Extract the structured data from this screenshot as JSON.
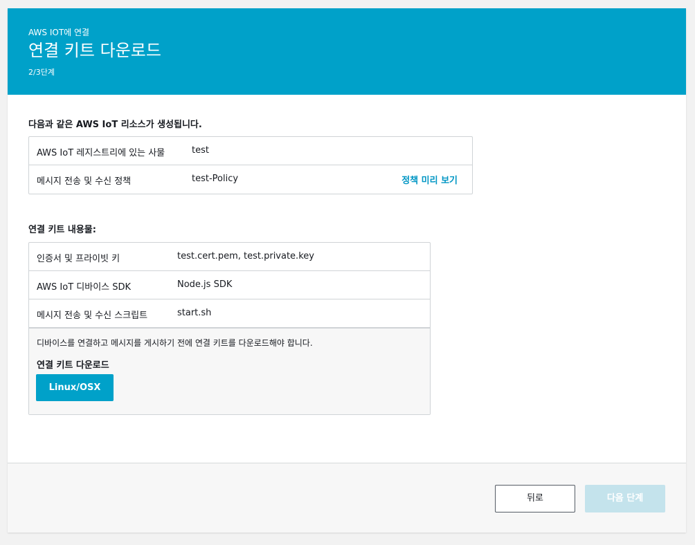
{
  "header": {
    "breadcrumb": "AWS IOT에 연결",
    "title": "연결 키트 다운로드",
    "step": "2/3단계"
  },
  "resources": {
    "title": "다음과 같은 AWS IoT 리소스가 생성됩니다.",
    "rows": [
      {
        "label": "AWS IoT 레지스트리에 있는 사물",
        "value": "test",
        "link": ""
      },
      {
        "label": "메시지 전송 및 수신 정책",
        "value": "test-Policy",
        "link": "정책 미리 보기"
      }
    ]
  },
  "kit": {
    "title": "연결 키트 내용물:",
    "rows": [
      {
        "label": "인증서 및 프라이빗 키",
        "value": "test.cert.pem, test.private.key"
      },
      {
        "label": "AWS IoT 디바이스 SDK",
        "value": "Node.js SDK"
      },
      {
        "label": "메시지 전송 및 수신 스크립트",
        "value": "start.sh"
      }
    ],
    "note": "디바이스를 연결하고 메시지를 게시하기 전에 연결 키트를 다운로드해야 합니다.",
    "download_label": "연결 키트 다운로드",
    "download_button": "Linux/OSX"
  },
  "footer": {
    "back_label": "뒤로",
    "next_label": "다음 단계"
  },
  "colors": {
    "header_bg": "#00a1c9",
    "primary_button": "#00a1c9",
    "disabled_button": "#c4e3ec",
    "link": "#0096c4"
  }
}
